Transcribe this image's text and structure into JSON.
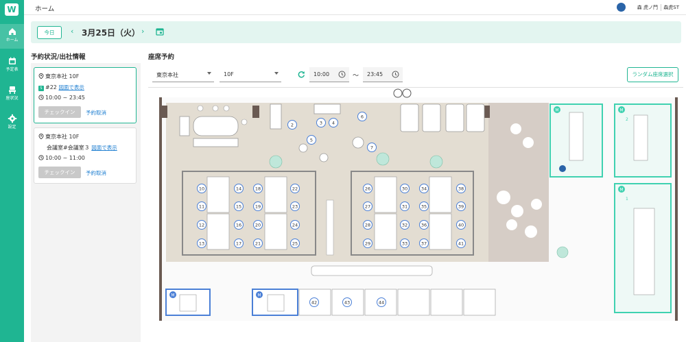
{
  "app": {
    "logo_letter": "W"
  },
  "sidebar": {
    "items": [
      {
        "label": "ホーム",
        "icon": "home-icon",
        "active": true
      },
      {
        "label": "予定表",
        "icon": "calendar-icon",
        "active": false
      },
      {
        "label": "座状況",
        "icon": "seat-icon",
        "active": false
      },
      {
        "label": "設定",
        "icon": "gear-icon",
        "active": false
      }
    ]
  },
  "header": {
    "title": "ホーム",
    "user_name": "森 虎ノ門",
    "org_name": "森虎ST"
  },
  "datebar": {
    "today_label": "今日",
    "date": "3月25日（火）"
  },
  "left": {
    "title": "予約状況/出社情報",
    "cards": [
      {
        "location": "東京本社 10F",
        "seat": "#22",
        "map_link": "図面で表示",
        "time": "10:00 ~ 23:45",
        "checkin": "チェックイン",
        "cancel": "予約取消"
      },
      {
        "location": "東京本社 10F",
        "seat": "会議室#会議室３",
        "map_link": "図面で表示",
        "time": "10:00 ~ 11:00",
        "checkin": "チェックイン",
        "cancel": "予約取消"
      }
    ]
  },
  "right": {
    "title": "座席予約",
    "office": "東京本社",
    "floor": "10F",
    "start_time": "10:00",
    "tilde": "〜",
    "end_time": "23:45",
    "random_button": "ランダム座席選択"
  },
  "floor_map": {
    "seats_center_left": [
      "10",
      "14",
      "18",
      "22",
      "11",
      "15",
      "19",
      "23",
      "12",
      "16",
      "20",
      "24",
      "13",
      "17",
      "21",
      "25"
    ],
    "seats_center_right": [
      "26",
      "30",
      "34",
      "38",
      "27",
      "31",
      "35",
      "39",
      "28",
      "32",
      "36",
      "40",
      "29",
      "33",
      "37",
      "41"
    ],
    "seats_top": [
      "2",
      "3",
      "4",
      "5",
      "6",
      "7"
    ],
    "seats_bottom": [
      "42",
      "43",
      "44"
    ],
    "room_badge": "M",
    "room_number": "1",
    "room_number_2": "2"
  },
  "colors": {
    "brand": "#1fb592",
    "room_green": "#3fd1b0",
    "room_blue": "#4a7fd6"
  }
}
